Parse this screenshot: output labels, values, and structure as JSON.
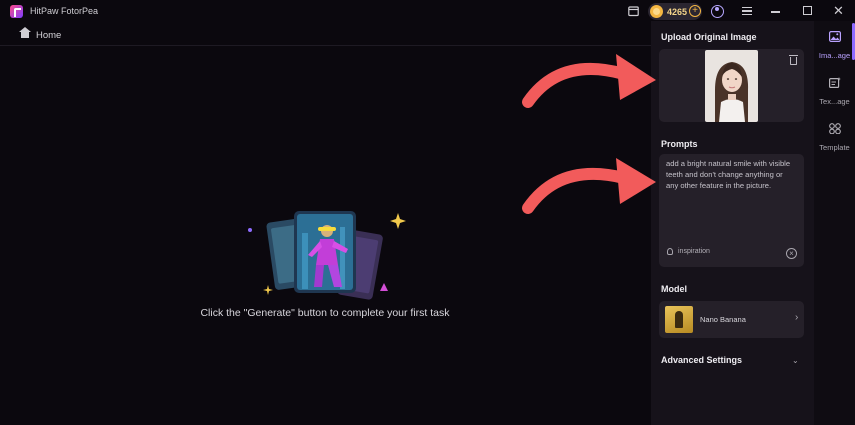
{
  "titlebar": {
    "app_name": "HitPaw FotorPea",
    "coin_count": "4265",
    "icons": [
      "app-logo-icon",
      "screen-icon",
      "coin-icon",
      "add-coins-icon",
      "user-icon",
      "menu-icon",
      "minimize-icon",
      "restore-icon",
      "close-icon"
    ]
  },
  "nav": {
    "home_label": "Home"
  },
  "main": {
    "empty_message": "Click the \"Generate\" button to complete your first task"
  },
  "panel": {
    "upload_title": "Upload Original Image",
    "prompts_title": "Prompts",
    "prompt_text": "add a bright natural smile with visible teeth and don't change anything or any other feature in the picture.",
    "inspiration_label": "inspiration",
    "model_title": "Model",
    "model_name": "Nano Banana",
    "advanced_title": "Advanced Settings"
  },
  "rail": {
    "items": [
      {
        "label": "Ima...age",
        "icon": "image-icon",
        "active": true
      },
      {
        "label": "Tex...age",
        "icon": "text-image-icon",
        "active": false
      },
      {
        "label": "Template",
        "icon": "template-icon",
        "active": false
      }
    ]
  },
  "colors": {
    "background": "#0b080e",
    "panel": "#16121a",
    "card": "#252029",
    "accent": "#8e6bff",
    "coin": "#f4b642",
    "annotation_arrow": "#f25b5b"
  }
}
